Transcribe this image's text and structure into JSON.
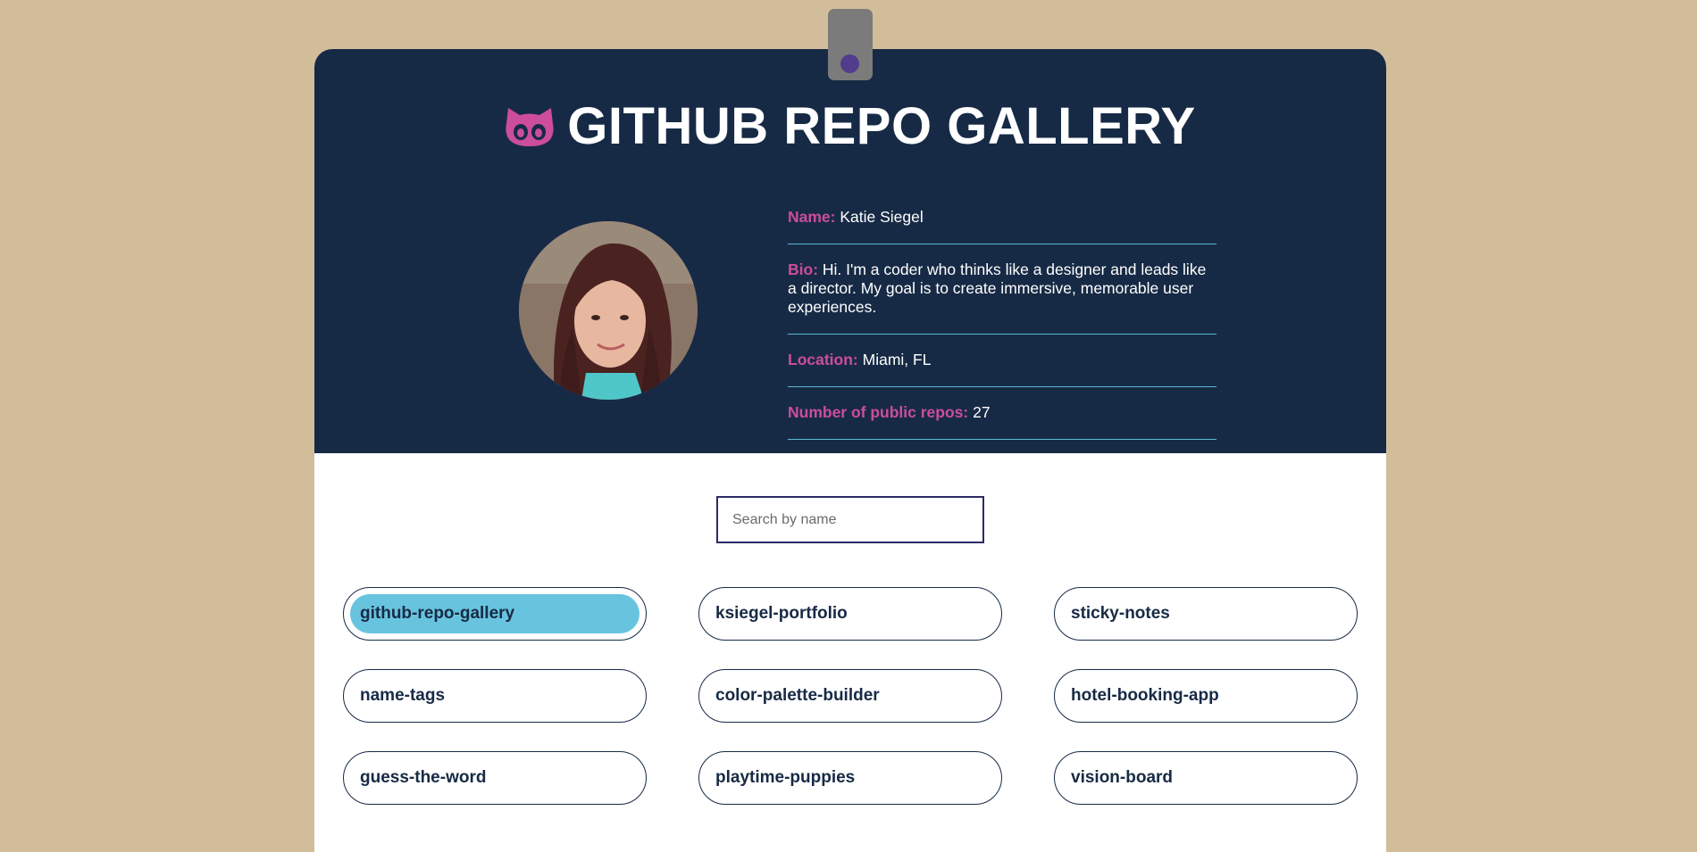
{
  "header": {
    "title": "GITHUB REPO GALLERY",
    "logo_icon": "github-octocat-icon"
  },
  "profile": {
    "name_label": "Name:",
    "name": "Katie Siegel",
    "bio_label": "Bio:",
    "bio": "Hi. I'm a coder who thinks like a designer and leads like a director. My goal is to create immersive, memorable user experiences.",
    "location_label": "Location:",
    "location": "Miami, FL",
    "repos_label": "Number of public repos:",
    "repos_count": "27"
  },
  "search": {
    "placeholder": "Search by name",
    "value": ""
  },
  "repos": [
    {
      "name": "github-repo-gallery",
      "active": true
    },
    {
      "name": "ksiegel-portfolio",
      "active": false
    },
    {
      "name": "sticky-notes",
      "active": false
    },
    {
      "name": "name-tags",
      "active": false
    },
    {
      "name": "color-palette-builder",
      "active": false
    },
    {
      "name": "hotel-booking-app",
      "active": false
    },
    {
      "name": "guess-the-word",
      "active": false
    },
    {
      "name": "playtime-puppies",
      "active": false
    },
    {
      "name": "vision-board",
      "active": false
    }
  ],
  "colors": {
    "page_background": "#d2bd9b",
    "header_background": "#172a45",
    "accent_pink": "#cc4d9c",
    "accent_blue": "#68c4de",
    "clip_gray": "#7b7b7b",
    "clip_dot": "#523d8c"
  }
}
